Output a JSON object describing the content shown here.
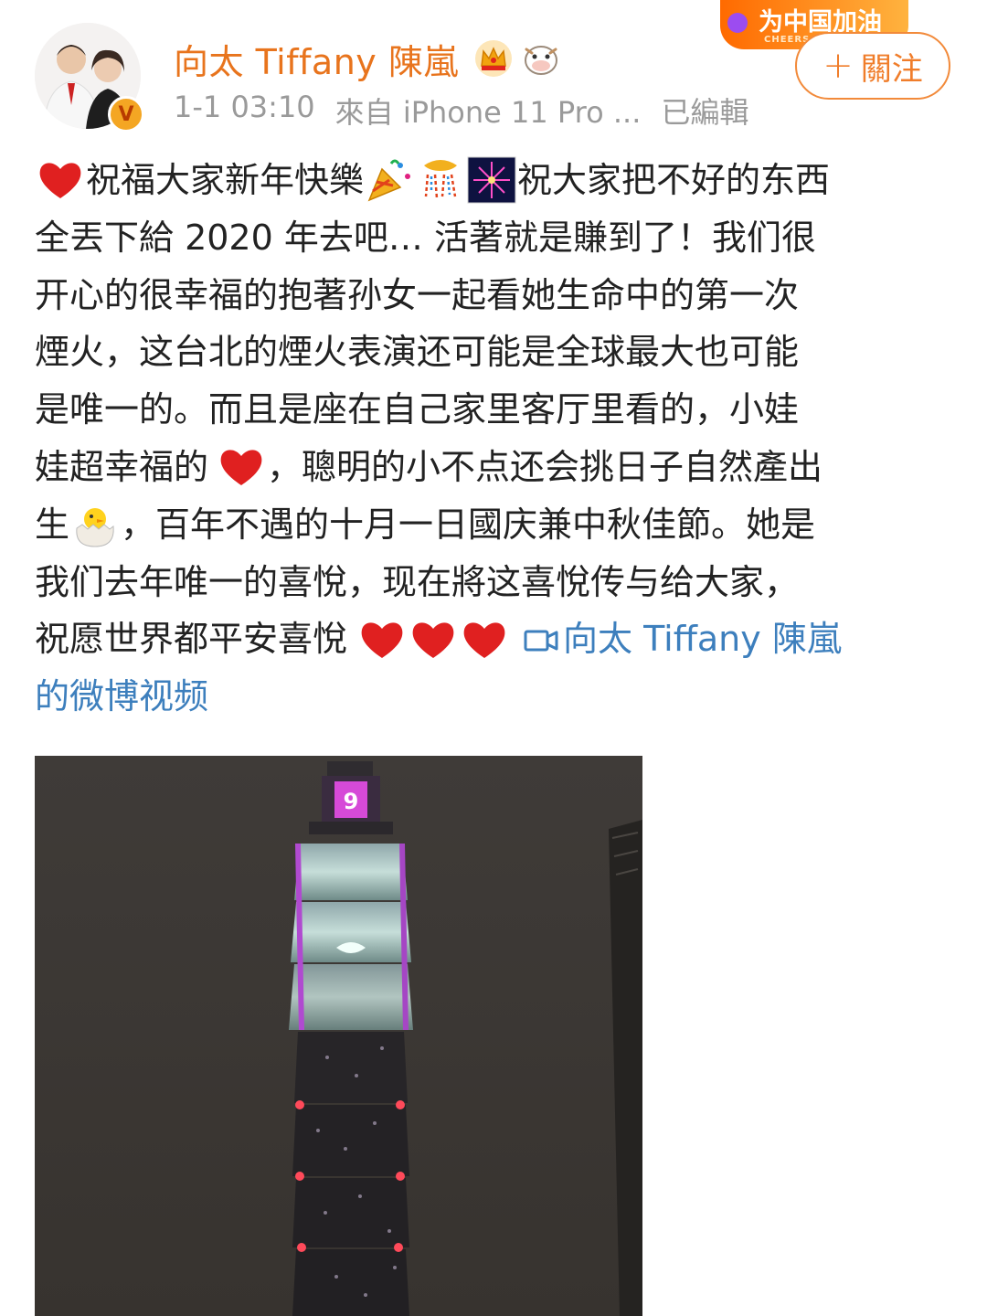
{
  "header": {
    "user_name": "向太 Tiffany 陳嵐",
    "timestamp": "1-1 03:10",
    "source": "來自 iPhone 11 Pro ...",
    "edited": "已編輯",
    "follow_label": "關注",
    "banner_text": "为中国加油",
    "banner_sub": "CHEERS FO"
  },
  "post": {
    "l1a": "祝福大家新年快樂",
    "l1b": "祝大家把不好的东西",
    "l2": "全丟下給 2020 年去吧… 活著就是賺到了！我们很",
    "l3": "开心的很幸福的抱著孙女一起看她生命中的第一次",
    "l4": "煙火，这台北的煙火表演还可能是全球最大也可能",
    "l5": "是唯一的。而且是座在自己家里客厅里看的，小娃",
    "l6a": "娃超幸福的",
    "l6b": "，聰明的小不点还会挑日子自然產出",
    "l7a": "生",
    "l7b": "，百年不遇的十月一日國庆兼中秋佳節。她是",
    "l8": "我们去年唯一的喜悅，现在將这喜悅传与给大家，",
    "l9": "祝愿世界都平安喜悅",
    "video_link_a": "向太 Tiffany 陳嵐",
    "video_link_b": "的微博视频"
  },
  "video": {
    "screen_digit": "9"
  },
  "colors": {
    "name_orange": "#e8741d",
    "link_blue": "#3d7fbd",
    "meta_gray": "#9a9a9a"
  }
}
